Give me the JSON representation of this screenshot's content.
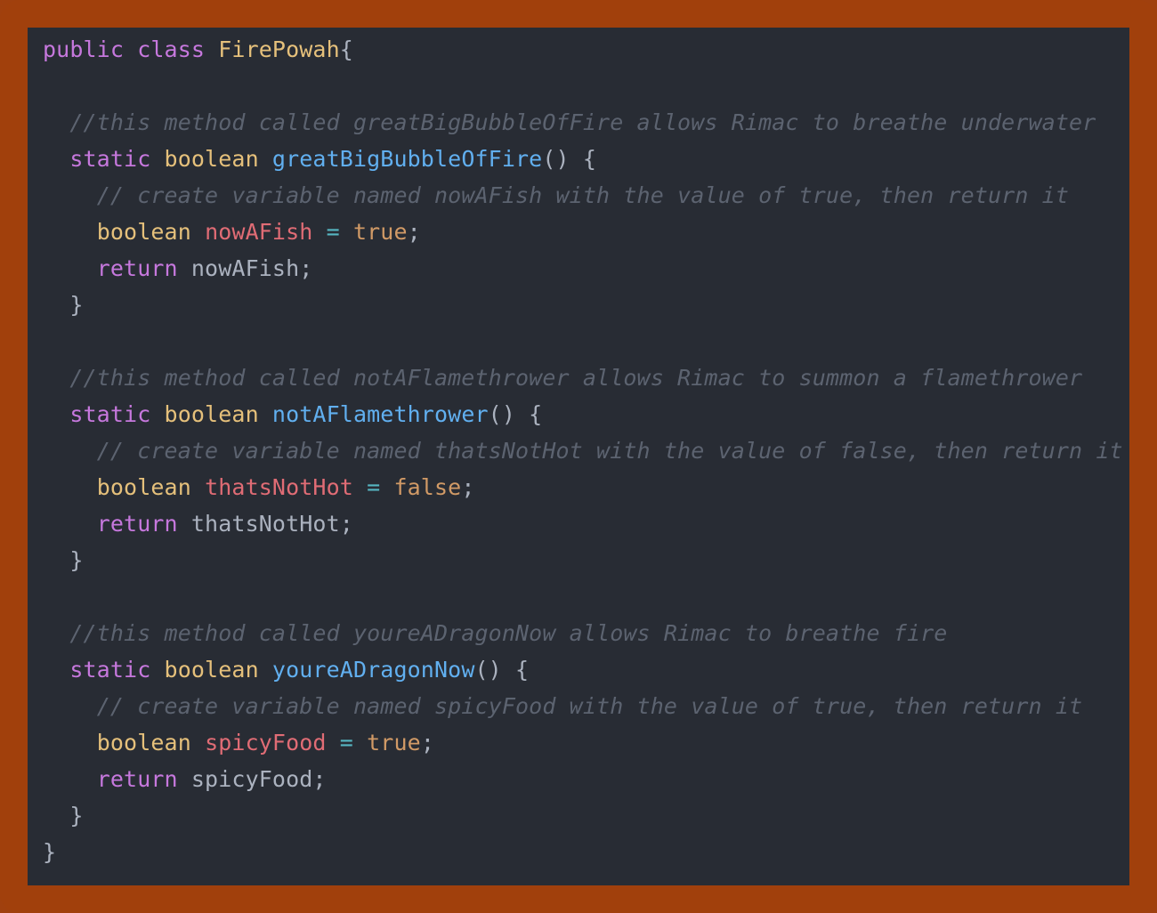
{
  "code": {
    "language": "java",
    "lines": [
      {
        "indent": "",
        "tokens": [
          {
            "t": "kw",
            "v": "public"
          },
          {
            "t": "pl",
            "v": " "
          },
          {
            "t": "kw",
            "v": "class"
          },
          {
            "t": "pl",
            "v": " "
          },
          {
            "t": "ty",
            "v": "FirePowah"
          },
          {
            "t": "pl",
            "v": "{"
          }
        ]
      },
      {
        "indent": "",
        "tokens": []
      },
      {
        "indent": "  ",
        "tokens": [
          {
            "t": "cm",
            "v": "//this method called greatBigBubbleOfFire allows Rimac to breathe underwater"
          }
        ]
      },
      {
        "indent": "  ",
        "tokens": [
          {
            "t": "kw",
            "v": "static"
          },
          {
            "t": "pl",
            "v": " "
          },
          {
            "t": "ty",
            "v": "boolean"
          },
          {
            "t": "pl",
            "v": " "
          },
          {
            "t": "fn",
            "v": "greatBigBubbleOfFire"
          },
          {
            "t": "pl",
            "v": "() {"
          }
        ]
      },
      {
        "indent": "    ",
        "tokens": [
          {
            "t": "cm",
            "v": "// create variable named nowAFish with the value of true, then return it"
          }
        ]
      },
      {
        "indent": "    ",
        "tokens": [
          {
            "t": "ty",
            "v": "boolean"
          },
          {
            "t": "pl",
            "v": " "
          },
          {
            "t": "var",
            "v": "nowAFish"
          },
          {
            "t": "pl",
            "v": " "
          },
          {
            "t": "op",
            "v": "="
          },
          {
            "t": "pl",
            "v": " "
          },
          {
            "t": "lit",
            "v": "true"
          },
          {
            "t": "pl",
            "v": ";"
          }
        ]
      },
      {
        "indent": "    ",
        "tokens": [
          {
            "t": "kw",
            "v": "return"
          },
          {
            "t": "pl",
            "v": " nowAFish;"
          }
        ]
      },
      {
        "indent": "  ",
        "tokens": [
          {
            "t": "pl",
            "v": "}"
          }
        ]
      },
      {
        "indent": "",
        "tokens": []
      },
      {
        "indent": "  ",
        "tokens": [
          {
            "t": "cm",
            "v": "//this method called notAFlamethrower allows Rimac to summon a flamethrower"
          }
        ]
      },
      {
        "indent": "  ",
        "tokens": [
          {
            "t": "kw",
            "v": "static"
          },
          {
            "t": "pl",
            "v": " "
          },
          {
            "t": "ty",
            "v": "boolean"
          },
          {
            "t": "pl",
            "v": " "
          },
          {
            "t": "fn",
            "v": "notAFlamethrower"
          },
          {
            "t": "pl",
            "v": "() {"
          }
        ]
      },
      {
        "indent": "    ",
        "tokens": [
          {
            "t": "cm",
            "v": "// create variable named thatsNotHot with the value of false, then return it"
          }
        ]
      },
      {
        "indent": "    ",
        "tokens": [
          {
            "t": "ty",
            "v": "boolean"
          },
          {
            "t": "pl",
            "v": " "
          },
          {
            "t": "var",
            "v": "thatsNotHot"
          },
          {
            "t": "pl",
            "v": " "
          },
          {
            "t": "op",
            "v": "="
          },
          {
            "t": "pl",
            "v": " "
          },
          {
            "t": "lit",
            "v": "false"
          },
          {
            "t": "pl",
            "v": ";"
          }
        ]
      },
      {
        "indent": "    ",
        "tokens": [
          {
            "t": "kw",
            "v": "return"
          },
          {
            "t": "pl",
            "v": " thatsNotHot;"
          }
        ]
      },
      {
        "indent": "  ",
        "tokens": [
          {
            "t": "pl",
            "v": "}"
          }
        ]
      },
      {
        "indent": "",
        "tokens": []
      },
      {
        "indent": "  ",
        "tokens": [
          {
            "t": "cm",
            "v": "//this method called youreADragonNow allows Rimac to breathe fire"
          }
        ]
      },
      {
        "indent": "  ",
        "tokens": [
          {
            "t": "kw",
            "v": "static"
          },
          {
            "t": "pl",
            "v": " "
          },
          {
            "t": "ty",
            "v": "boolean"
          },
          {
            "t": "pl",
            "v": " "
          },
          {
            "t": "fn",
            "v": "youreADragonNow"
          },
          {
            "t": "pl",
            "v": "() {"
          }
        ]
      },
      {
        "indent": "    ",
        "tokens": [
          {
            "t": "cm",
            "v": "// create variable named spicyFood with the value of true, then return it"
          }
        ]
      },
      {
        "indent": "    ",
        "tokens": [
          {
            "t": "ty",
            "v": "boolean"
          },
          {
            "t": "pl",
            "v": " "
          },
          {
            "t": "var",
            "v": "spicyFood"
          },
          {
            "t": "pl",
            "v": " "
          },
          {
            "t": "op",
            "v": "="
          },
          {
            "t": "pl",
            "v": " "
          },
          {
            "t": "lit",
            "v": "true"
          },
          {
            "t": "pl",
            "v": ";"
          }
        ]
      },
      {
        "indent": "    ",
        "tokens": [
          {
            "t": "kw",
            "v": "return"
          },
          {
            "t": "pl",
            "v": " spicyFood;"
          }
        ]
      },
      {
        "indent": "  ",
        "tokens": [
          {
            "t": "pl",
            "v": "}"
          }
        ]
      },
      {
        "indent": "",
        "tokens": [
          {
            "t": "pl",
            "v": "}"
          }
        ]
      }
    ]
  },
  "colors": {
    "frame": "#a1400c",
    "editor_background": "#282c34",
    "keyword": "#c678dd",
    "type": "#e5c07b",
    "function": "#61afef",
    "variable": "#e06c75",
    "operator": "#56b6c2",
    "literal": "#d19a66",
    "plain": "#abb2bf",
    "comment": "#5c6370"
  }
}
